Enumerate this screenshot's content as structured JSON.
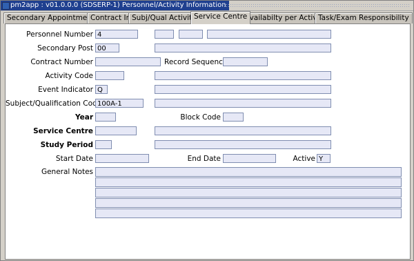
{
  "window": {
    "title": "pm2app : v01.0.0.0 (SDSERP-1) Personnel/Activity Information"
  },
  "tabs": [
    {
      "label": "Secondary Appointment"
    },
    {
      "label": "Contract Info"
    },
    {
      "label": "Subj/Qual Activity"
    },
    {
      "label": "Service Centre"
    },
    {
      "label": "Availabilty per Activity"
    },
    {
      "label": "Task/Exam Responsibility"
    }
  ],
  "form": {
    "personnel_number": {
      "label": "Personnel Number",
      "value": "4"
    },
    "secondary_post": {
      "label": "Secondary Post",
      "value": "00"
    },
    "contract_number": {
      "label": "Contract Number",
      "value": ""
    },
    "record_sequence": {
      "label": "Record Sequence",
      "value": ""
    },
    "activity_code": {
      "label": "Activity Code",
      "value": ""
    },
    "event_indicator": {
      "label": "Event Indicator",
      "value": "Q"
    },
    "subject_qual_code": {
      "label": "Subject/Qualification Code",
      "value": "100A-1"
    },
    "year": {
      "label": "Year",
      "value": ""
    },
    "block_code": {
      "label": "Block Code",
      "value": ""
    },
    "service_centre": {
      "label": "Service Centre",
      "value": ""
    },
    "study_period": {
      "label": "Study Period",
      "value": ""
    },
    "start_date": {
      "label": "Start Date",
      "value": ""
    },
    "end_date": {
      "label": "End Date",
      "value": ""
    },
    "active": {
      "label": "Active",
      "value": "Y"
    },
    "general_notes": {
      "label": "General Notes",
      "lines": [
        "",
        "",
        "",
        "",
        ""
      ]
    }
  },
  "colors": {
    "field_bg": "#e6e8f6",
    "title_bg": "#1f3f8f",
    "window_bg": "#d4d0c8"
  }
}
